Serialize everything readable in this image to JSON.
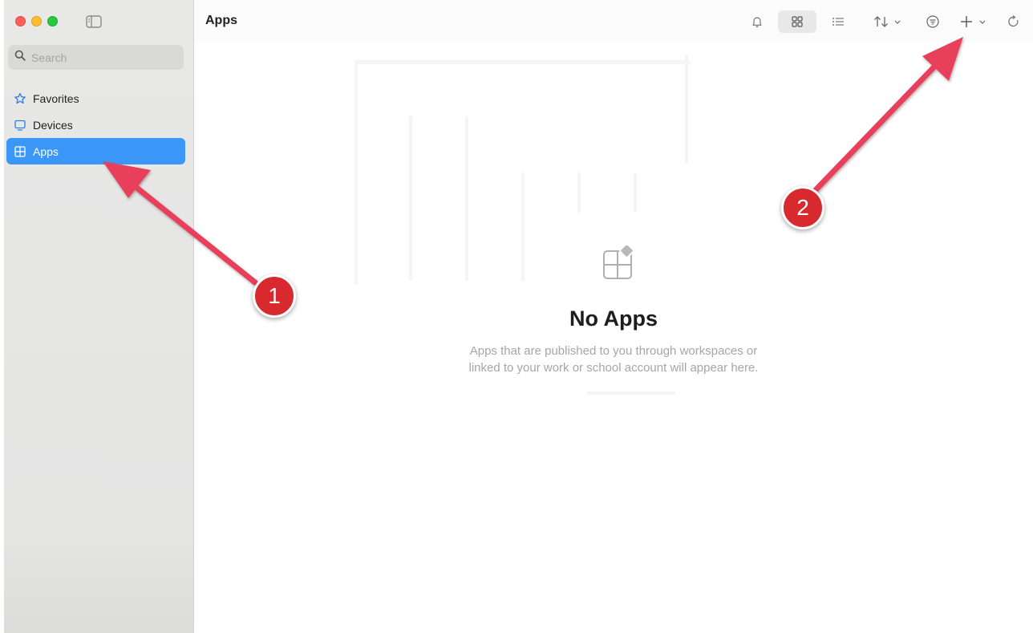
{
  "window": {
    "traffic_lights": [
      "close",
      "minimize",
      "zoom"
    ]
  },
  "sidebar": {
    "search": {
      "placeholder": "Search",
      "value": ""
    },
    "items": [
      {
        "label": "Favorites",
        "icon": "star-icon",
        "active": false
      },
      {
        "label": "Devices",
        "icon": "monitor-icon",
        "active": false
      },
      {
        "label": "Apps",
        "icon": "apps-grid-icon",
        "active": true
      }
    ]
  },
  "header": {
    "title": "Apps",
    "toolbar_icons": [
      "bell-icon",
      "grid-view-icon",
      "list-view-icon",
      "sort-icon",
      "filter-icon",
      "add-icon",
      "refresh-icon"
    ],
    "selected_view": "grid"
  },
  "empty_state": {
    "title": "No Apps",
    "description_line1": "Apps that are published to you through workspaces or",
    "description_line2": "linked to your work or school account will appear here."
  },
  "annotations": [
    {
      "label": "1",
      "target": "Apps sidebar item"
    },
    {
      "label": "2",
      "target": "Add button"
    }
  ],
  "colors": {
    "accent": "#3a97f7",
    "annotation": "#e8415a",
    "badge": "#d8292f"
  }
}
